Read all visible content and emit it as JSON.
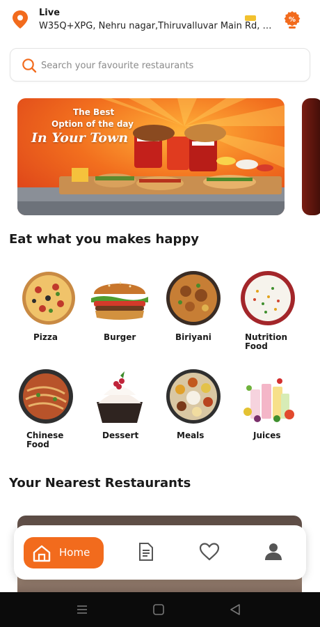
{
  "header": {
    "title": "Live",
    "address": "W35Q+XPG, Nehru nagar,Thiruvalluvar Main Rd, M..."
  },
  "search": {
    "placeholder": "Search your favourite restaurants"
  },
  "banner": {
    "line1": "The Best",
    "line2": "Option of the day",
    "line3": "In Your Town"
  },
  "sections": {
    "categories_title": "Eat what you makes happy",
    "restaurants_title": "Your Nearest Restaurants"
  },
  "categories": [
    {
      "label": "Pizza"
    },
    {
      "label": "Burger"
    },
    {
      "label": "Biriyani"
    },
    {
      "label": "Nutrition Food"
    },
    {
      "label": "Chinese Food"
    },
    {
      "label": "Dessert"
    },
    {
      "label": "Meals"
    },
    {
      "label": "Juices"
    }
  ],
  "nav": {
    "home_label": "Home"
  },
  "colors": {
    "accent": "#f26b1d",
    "icon_gray": "#555555"
  }
}
